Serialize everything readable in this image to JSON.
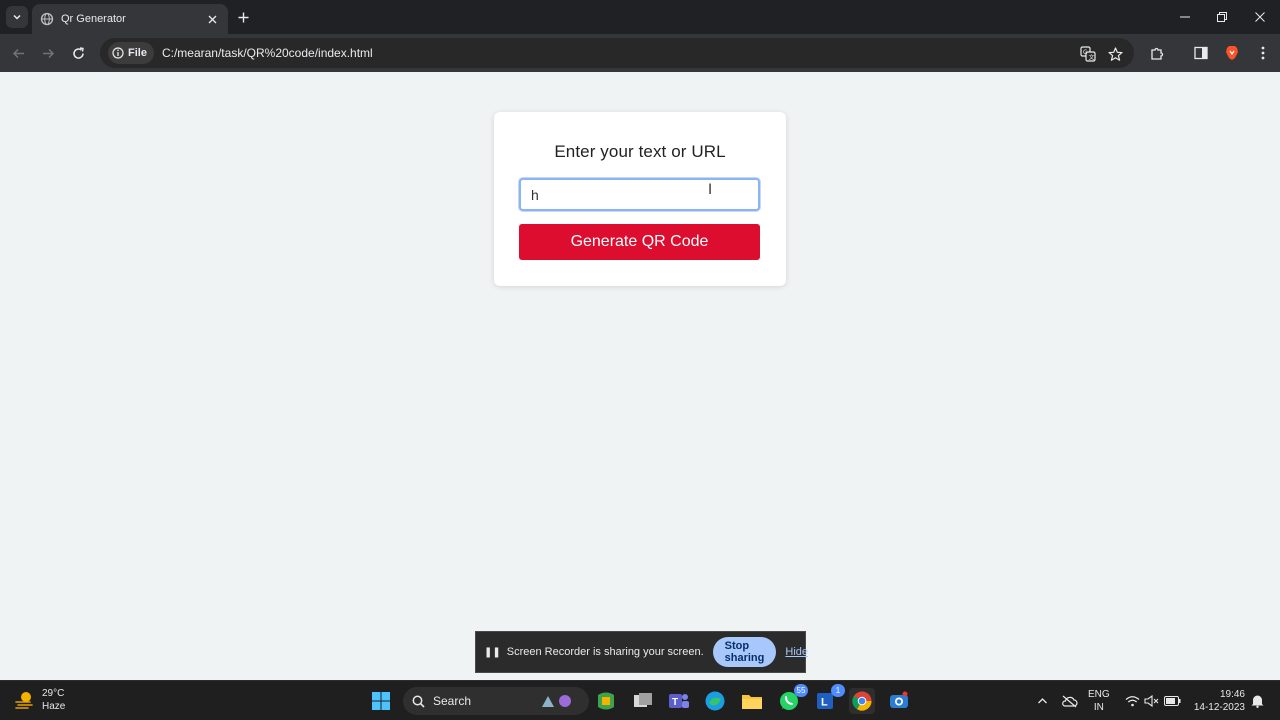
{
  "browser": {
    "tab": {
      "title": "Qr Generator"
    },
    "address": {
      "chip_label": "File",
      "url": "C:/mearan/task/QR%20code/index.html"
    }
  },
  "page": {
    "heading": "Enter your text or URL",
    "input_value": "h",
    "generate_label": "Generate QR Code"
  },
  "share_bar": {
    "message": "Screen Recorder is sharing your screen.",
    "stop_label": "Stop sharing",
    "hide_label": "Hide"
  },
  "taskbar": {
    "weather": {
      "temp": "29°C",
      "condition": "Haze"
    },
    "search_label": "Search",
    "whatsapp_badge": "55",
    "teams_badge": "1",
    "lang_top": "ENG",
    "lang_bottom": "IN",
    "time": "19:46",
    "date": "14-12-2023"
  },
  "colors": {
    "accent_red": "#dc0d2e",
    "input_focus": "#8ab4f8",
    "page_bg": "#eff3f4"
  }
}
